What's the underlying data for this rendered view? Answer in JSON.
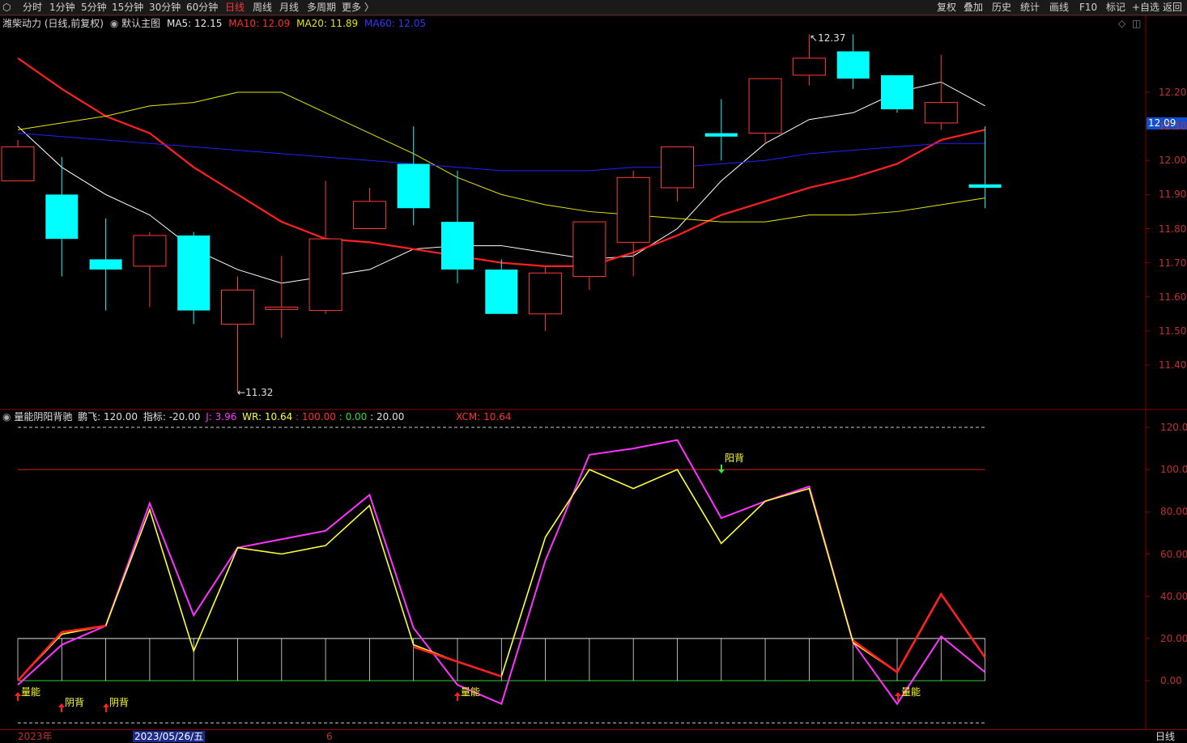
{
  "topbar": {
    "menu_icon": "window-menu-icon",
    "left_tabs": [
      "分时",
      "1分钟",
      "5分钟",
      "15分钟",
      "30分钟",
      "60分钟",
      "日线",
      "周线",
      "月线",
      "多周期",
      "更多 〉"
    ],
    "active_tab": "日线",
    "right_buttons": [
      "复权",
      "叠加",
      "历史",
      "统计",
      "画线",
      "F10",
      "标记",
      "+自选",
      "返回"
    ]
  },
  "main": {
    "title": "潍柴动力 (日线,前复权)",
    "template": "默认主图",
    "ma5_label": "MA5: 12.15",
    "ma10_label": "MA10: 12.09",
    "ma20_label": "MA20: 11.89",
    "ma60_label": "MA60: 12.05",
    "high_marker": "12.37",
    "low_marker": "11.32",
    "current_price_tag": "12.09",
    "y_ticks": [
      "12.20",
      "12.10",
      "12.00",
      "11.90",
      "11.80",
      "11.70",
      "11.60",
      "11.50",
      "11.40"
    ],
    "colors": {
      "up": "#ff3a3a",
      "down": "#00ffff",
      "ma5": "#ffffff",
      "ma10": "#ff2020",
      "ma20": "#e6e600",
      "ma60": "#2020ff"
    }
  },
  "indicator": {
    "name": "量能阴阳背驰",
    "pengfei_label": "鹏飞: 120.00",
    "zhibiao_label": "指标: -20.00",
    "j_label": "J: 3.96",
    "wr_label": "WR: 10.64",
    "v100_label": ": 100.00",
    "v0_label": ": 0.00",
    "v20_label": ": 20.00",
    "xcm_label": "XCM: 10.64",
    "y_ticks": [
      "120.00",
      "100.00",
      "80.00",
      "60.00",
      "40.00",
      "20.00",
      "0.00"
    ],
    "signals": {
      "yangbei": "阳背",
      "yinbei": "阴背",
      "liangneng": "量能"
    }
  },
  "bottom": {
    "year_label": "2023年",
    "date_label": "2023/05/26/五",
    "month_label": "6",
    "period_label": "日线"
  },
  "chart_data": [
    {
      "type": "candlestick",
      "title": "潍柴动力 (日线,前复权)",
      "ylim": [
        11.3,
        12.4
      ],
      "candles": [
        {
          "o": 11.94,
          "c": 12.04,
          "h": 12.06,
          "l": 11.94
        },
        {
          "o": 11.9,
          "c": 11.77,
          "h": 12.01,
          "l": 11.66
        },
        {
          "o": 11.71,
          "c": 11.68,
          "h": 11.83,
          "l": 11.56
        },
        {
          "o": 11.69,
          "c": 11.78,
          "h": 11.79,
          "l": 11.57
        },
        {
          "o": 11.78,
          "c": 11.56,
          "h": 11.79,
          "l": 11.52
        },
        {
          "o": 11.52,
          "c": 11.62,
          "h": 11.66,
          "l": 11.32
        },
        {
          "o": 11.57,
          "c": 11.57,
          "h": 11.72,
          "l": 11.48
        },
        {
          "o": 11.56,
          "c": 11.77,
          "h": 11.94,
          "l": 11.55
        },
        {
          "o": 11.8,
          "c": 11.88,
          "h": 11.92,
          "l": 11.8
        },
        {
          "o": 11.99,
          "c": 11.86,
          "h": 12.1,
          "l": 11.81
        },
        {
          "o": 11.82,
          "c": 11.68,
          "h": 11.97,
          "l": 11.64
        },
        {
          "o": 11.68,
          "c": 11.55,
          "h": 11.71,
          "l": 11.55
        },
        {
          "o": 11.55,
          "c": 11.67,
          "h": 11.69,
          "l": 11.5
        },
        {
          "o": 11.66,
          "c": 11.82,
          "h": 11.82,
          "l": 11.62
        },
        {
          "o": 11.76,
          "c": 11.95,
          "h": 11.97,
          "l": 11.66
        },
        {
          "o": 11.92,
          "c": 12.04,
          "h": 12.04,
          "l": 11.88
        },
        {
          "o": 12.08,
          "c": 12.07,
          "h": 12.18,
          "l": 12.0
        },
        {
          "o": 12.08,
          "c": 12.24,
          "h": 12.24,
          "l": 12.05
        },
        {
          "o": 12.25,
          "c": 12.3,
          "h": 12.37,
          "l": 12.22
        },
        {
          "o": 12.32,
          "c": 12.24,
          "h": 12.37,
          "l": 12.21
        },
        {
          "o": 12.25,
          "c": 12.15,
          "h": 12.25,
          "l": 12.14
        },
        {
          "o": 12.11,
          "c": 12.17,
          "h": 12.31,
          "l": 12.09
        },
        {
          "o": 11.93,
          "c": 11.92,
          "h": 12.1,
          "l": 11.86
        }
      ],
      "series": [
        {
          "name": "MA5",
          "values": [
            12.1,
            11.98,
            11.9,
            11.84,
            11.74,
            11.68,
            11.64,
            11.66,
            11.68,
            11.74,
            11.75,
            11.75,
            11.73,
            11.71,
            11.72,
            11.8,
            11.94,
            12.05,
            12.12,
            12.14,
            12.2,
            12.23,
            12.16
          ]
        },
        {
          "name": "MA10",
          "values": [
            12.3,
            12.21,
            12.13,
            12.08,
            11.98,
            11.9,
            11.82,
            11.77,
            11.76,
            11.74,
            11.72,
            11.7,
            11.69,
            11.69,
            11.73,
            11.78,
            11.84,
            11.88,
            11.92,
            11.95,
            11.99,
            12.06,
            12.09
          ]
        },
        {
          "name": "MA20",
          "values": [
            12.09,
            12.11,
            12.13,
            12.16,
            12.17,
            12.2,
            12.2,
            12.14,
            12.08,
            12.02,
            11.95,
            11.9,
            11.87,
            11.85,
            11.84,
            11.83,
            11.82,
            11.82,
            11.84,
            11.84,
            11.85,
            11.87,
            11.89
          ]
        },
        {
          "name": "MA60",
          "values": [
            12.08,
            12.07,
            12.06,
            12.05,
            12.04,
            12.03,
            12.02,
            12.01,
            12.0,
            11.99,
            11.98,
            11.97,
            11.97,
            11.97,
            11.98,
            11.98,
            11.99,
            12.0,
            12.02,
            12.03,
            12.04,
            12.05,
            12.05
          ]
        }
      ]
    },
    {
      "type": "line",
      "title": "量能阴阳背驰",
      "ylim": [
        -20,
        120
      ],
      "series": [
        {
          "name": "J",
          "values": [
            -2,
            17,
            26,
            84,
            31,
            63,
            67,
            71,
            88,
            25,
            -2,
            -11,
            57,
            107,
            110,
            114,
            77,
            85,
            92,
            18,
            -11,
            21,
            4
          ]
        },
        {
          "name": "WR",
          "values": [
            0,
            22,
            26,
            81,
            14,
            63,
            60,
            64,
            83,
            17,
            9,
            2,
            68,
            100,
            91,
            100,
            65,
            85,
            91,
            18,
            4,
            41,
            11
          ]
        },
        {
          "name": "XCM",
          "values": [
            0,
            23,
            26,
            null,
            null,
            null,
            null,
            null,
            null,
            16,
            9,
            2,
            null,
            null,
            null,
            null,
            null,
            null,
            null,
            19,
            4,
            41,
            11
          ]
        }
      ],
      "reference_lines": [
        120,
        100,
        20,
        0,
        -20
      ]
    }
  ]
}
